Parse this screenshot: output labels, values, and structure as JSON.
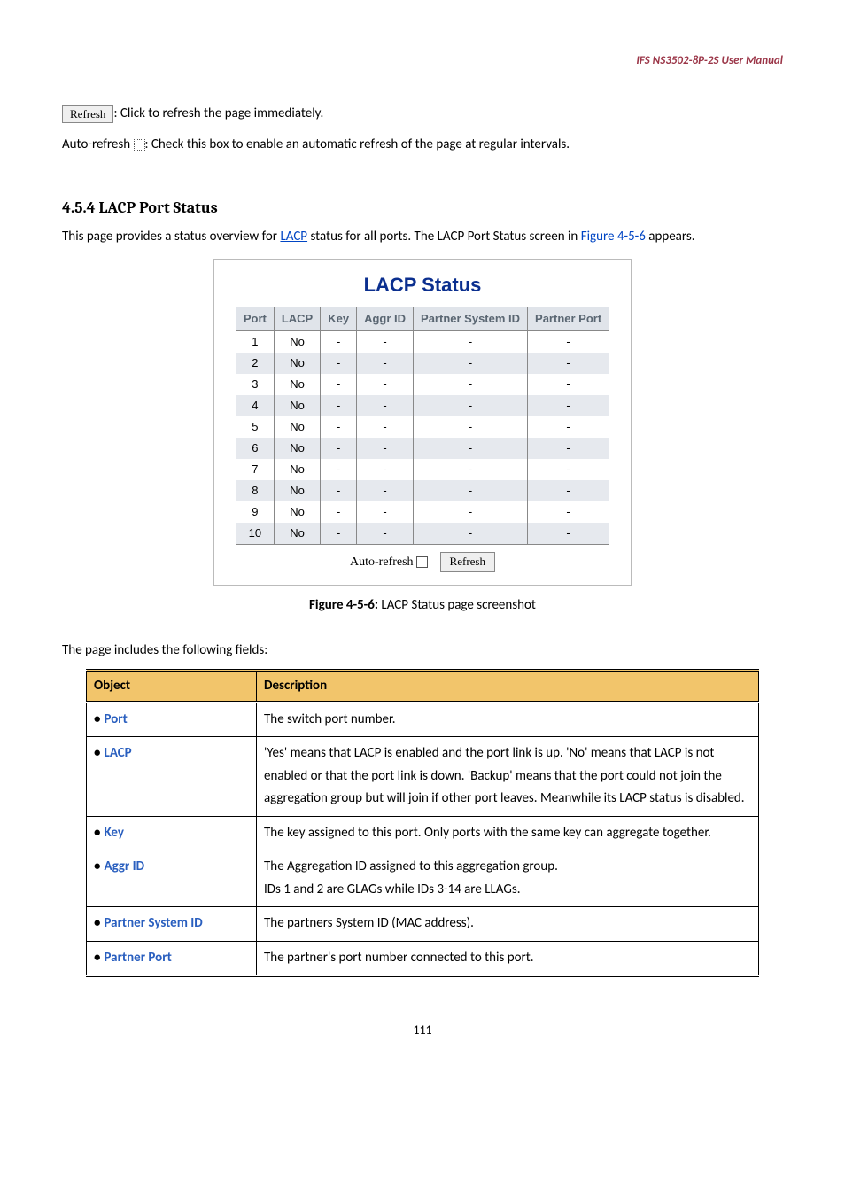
{
  "header": {
    "title": "IFS NS3502-8P-2S  User Manual"
  },
  "intro": {
    "refresh_btn": "Refresh",
    "refresh_desc": ": Click to refresh the page immediately.",
    "autorefresh_prefix": "Auto-refresh ",
    "autorefresh_desc": ": Check this box to enable an automatic refresh of the page at regular intervals."
  },
  "section": {
    "heading": "4.5.4 LACP Port Status",
    "line_a": "This page provides a status overview for ",
    "link": "LACP",
    "line_b": " status for all ports. The LACP Port Status screen in ",
    "figref": "Figure 4-5-6",
    "line_c": " appears."
  },
  "lacp": {
    "title": "LACP Status",
    "cols": {
      "port": "Port",
      "lacp": "LACP",
      "key": "Key",
      "aggr": "Aggr ID",
      "psys": "Partner System ID",
      "pport": "Partner Port"
    },
    "rows": [
      {
        "port": "1",
        "lacp": "No",
        "key": "-",
        "aggr": "-",
        "psys": "-",
        "pport": "-"
      },
      {
        "port": "2",
        "lacp": "No",
        "key": "-",
        "aggr": "-",
        "psys": "-",
        "pport": "-"
      },
      {
        "port": "3",
        "lacp": "No",
        "key": "-",
        "aggr": "-",
        "psys": "-",
        "pport": "-"
      },
      {
        "port": "4",
        "lacp": "No",
        "key": "-",
        "aggr": "-",
        "psys": "-",
        "pport": "-"
      },
      {
        "port": "5",
        "lacp": "No",
        "key": "-",
        "aggr": "-",
        "psys": "-",
        "pport": "-"
      },
      {
        "port": "6",
        "lacp": "No",
        "key": "-",
        "aggr": "-",
        "psys": "-",
        "pport": "-"
      },
      {
        "port": "7",
        "lacp": "No",
        "key": "-",
        "aggr": "-",
        "psys": "-",
        "pport": "-"
      },
      {
        "port": "8",
        "lacp": "No",
        "key": "-",
        "aggr": "-",
        "psys": "-",
        "pport": "-"
      },
      {
        "port": "9",
        "lacp": "No",
        "key": "-",
        "aggr": "-",
        "psys": "-",
        "pport": "-"
      },
      {
        "port": "10",
        "lacp": "No",
        "key": "-",
        "aggr": "-",
        "psys": "-",
        "pport": "-"
      }
    ],
    "autorefresh_label": "Auto-refresh",
    "refresh_btn": "Refresh"
  },
  "caption": {
    "bold": "Figure 4-5-6:",
    "rest": " LACP Status page screenshot"
  },
  "fields_intro": "The page includes the following fields:",
  "desc": {
    "h_obj": "Object",
    "h_desc": "Description",
    "rows": [
      {
        "label": "Port",
        "text": "The switch port number."
      },
      {
        "label": "LACP",
        "text": "'Yes' means that LACP is enabled and the port link is up. 'No' means that LACP is not enabled or that the port link is down. 'Backup' means that the port could not join the aggregation group but will join if other port leaves. Meanwhile its LACP status is disabled."
      },
      {
        "label": "Key",
        "text": "The key assigned to this port.    Only ports with the same key can aggregate together."
      },
      {
        "label": "Aggr ID",
        "text": "The Aggregation ID assigned to this aggregation group.",
        "text2": "IDs 1 and 2 are GLAGs while IDs 3-14 are LLAGs."
      },
      {
        "label": "Partner System ID",
        "text": "The partners System ID (MAC address)."
      },
      {
        "label": "Partner Port",
        "text": "The partner's port number connected to this port."
      }
    ]
  },
  "page_num": "111"
}
